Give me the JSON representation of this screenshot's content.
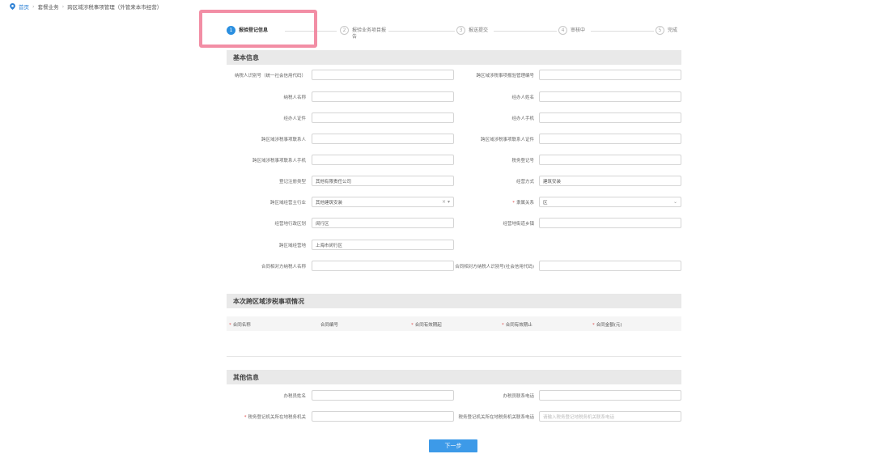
{
  "breadcrumb": {
    "home": "首页",
    "items": [
      "套餐业务",
      "跨区域涉税事项管理（外管来本市经营）"
    ]
  },
  "steps": [
    {
      "num": "1",
      "label": "报验登记信息"
    },
    {
      "num": "2",
      "label": "报验业务项目报告"
    },
    {
      "num": "3",
      "label": "报送提交"
    },
    {
      "num": "4",
      "label": "审核中"
    },
    {
      "num": "5",
      "label": "完成"
    }
  ],
  "sections": {
    "basic": "基本信息",
    "matters": "本次跨区域涉税事项情况",
    "other": "其他信息"
  },
  "basic_fields": {
    "taxpayer_id": {
      "label": "纳税人识别号（统一社会信用代码）",
      "value": ""
    },
    "cross_mgmt_no": {
      "label": "跨区域涉税事项报验管理编号",
      "value": ""
    },
    "taxpayer_name": {
      "label": "纳税人名称",
      "value": ""
    },
    "handler_name": {
      "label": "经办人姓名",
      "value": ""
    },
    "handler_id": {
      "label": "经办人证件",
      "value": ""
    },
    "handler_phone": {
      "label": "经办人手机",
      "value": ""
    },
    "contact_person": {
      "label": "跨区域涉税事项联系人",
      "value": ""
    },
    "contact_id": {
      "label": "跨区域涉税事项联系人证件",
      "value": ""
    },
    "contact_phone": {
      "label": "跨区域涉税事项联系人手机",
      "value": ""
    },
    "tax_reg_no": {
      "label": "税务登记号",
      "value": ""
    },
    "reg_type": {
      "label": "登记注册类型",
      "value": "其他有限责任公司"
    },
    "biz_mode": {
      "label": "经营方式",
      "value": "建筑安装"
    },
    "industry": {
      "label": "跨区域经营主行业",
      "value": "其他建筑安装"
    },
    "affiliation": {
      "label": "隶属关系",
      "value": "区"
    },
    "admin_area": {
      "label": "经营地行政区划",
      "value": "闵行区"
    },
    "street": {
      "label": "经营地街道乡镇",
      "value": ""
    },
    "address": {
      "label": "跨区域经营地",
      "value": "上海市闵行区"
    },
    "contract_party_name": {
      "label": "合同相对方纳税人名称",
      "value": ""
    },
    "contract_party_id": {
      "label": "合同相对方纳税人识别号(社会信用代码)",
      "value": ""
    }
  },
  "table": {
    "columns": [
      {
        "label": "合同名称",
        "required": true
      },
      {
        "label": "合同编号",
        "required": false
      },
      {
        "label": "合同有效期起",
        "required": true
      },
      {
        "label": "合同有效期止",
        "required": true
      },
      {
        "label": "合同金额(元)",
        "required": true
      }
    ]
  },
  "other_fields": {
    "finance_name": {
      "label": "办税员姓名",
      "value": ""
    },
    "finance_phone": {
      "label": "办税员联系电话",
      "value": ""
    },
    "tax_office": {
      "label": "税务登记机关所在地税务机关",
      "value": ""
    },
    "tax_office_phone": {
      "label": "税务登记机关所在地税务机关联系电话",
      "placeholder": "请输入税务登记地税务机关联系电话"
    }
  },
  "next_button": "下一步"
}
